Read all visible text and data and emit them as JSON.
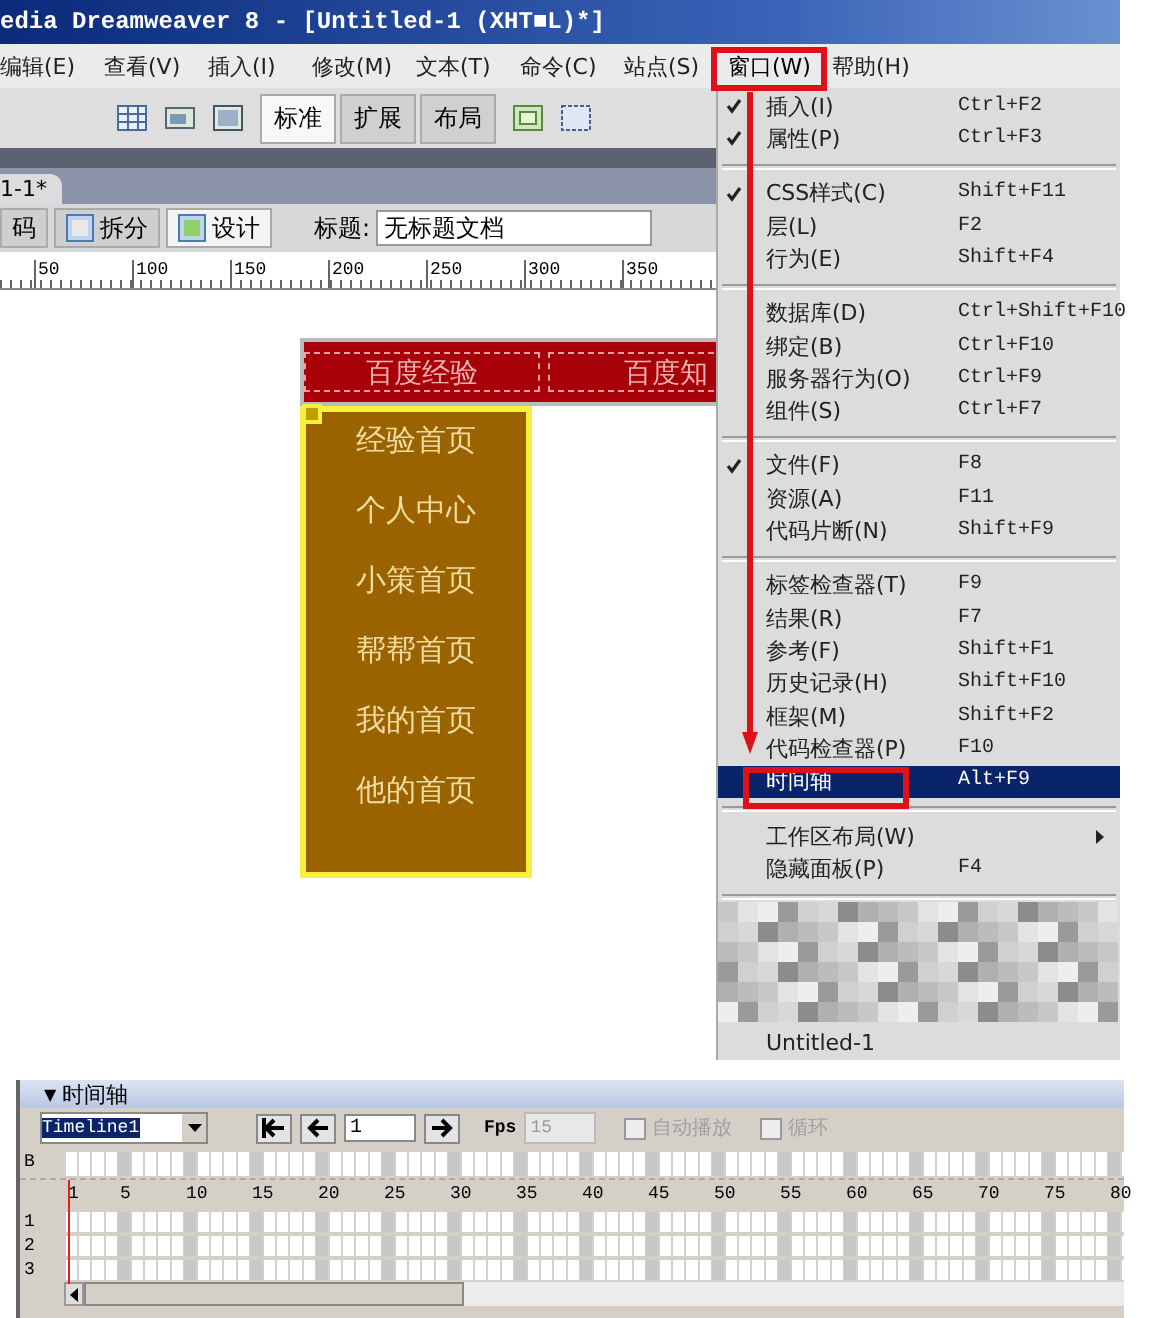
{
  "window": {
    "title": "edia Dreamweaver 8 - [Untitled-1 (XHT■L)*]"
  },
  "menu_bar": [
    {
      "label": "编辑(E)",
      "selected": false
    },
    {
      "label": "查看(V)",
      "selected": false
    },
    {
      "label": "插入(I)",
      "selected": false
    },
    {
      "label": "修改(M)",
      "selected": false
    },
    {
      "label": "文本(T)",
      "selected": false
    },
    {
      "label": "命令(C)",
      "selected": false
    },
    {
      "label": "站点(S)",
      "selected": false
    },
    {
      "label": "窗口(W)",
      "selected": true
    },
    {
      "label": "帮助(H)",
      "selected": false
    }
  ],
  "insert_tabs": [
    {
      "label": "标准",
      "selected": true
    },
    {
      "label": "扩展",
      "selected": false
    },
    {
      "label": "布局",
      "selected": false
    }
  ],
  "document_tab": {
    "label": "1-1*"
  },
  "view_buttons": [
    {
      "label": "码",
      "selected": false
    },
    {
      "label": "拆分",
      "selected": false
    },
    {
      "label": "设计",
      "selected": true
    }
  ],
  "title_field": {
    "label": "标题:",
    "value": "无标题文档"
  },
  "ruler": [
    "50",
    "100",
    "150",
    "200",
    "250",
    "300",
    "350"
  ],
  "nav_menu": {
    "items": [
      "百度经验",
      "百度知"
    ],
    "submenu": [
      "经验首页",
      "个人中心",
      "小策首页",
      "帮帮首页",
      "我的首页",
      "他的首页"
    ]
  },
  "window_menu": [
    [
      {
        "label": "插入(I)",
        "shortcut": "Ctrl+F2",
        "checked": true,
        "selected": false,
        "submenu": false
      },
      {
        "label": "属性(P)",
        "shortcut": "Ctrl+F3",
        "checked": true,
        "selected": false,
        "submenu": false
      }
    ],
    [
      {
        "label": "CSS样式(C)",
        "shortcut": "Shift+F11",
        "checked": true,
        "selected": false,
        "submenu": false
      },
      {
        "label": "层(L)",
        "shortcut": "F2",
        "checked": false,
        "selected": false,
        "submenu": false
      },
      {
        "label": "行为(E)",
        "shortcut": "Shift+F4",
        "checked": false,
        "selected": false,
        "submenu": false
      }
    ],
    [
      {
        "label": "数据库(D)",
        "shortcut": "Ctrl+Shift+F10",
        "checked": false,
        "selected": false,
        "submenu": false
      },
      {
        "label": "绑定(B)",
        "shortcut": "Ctrl+F10",
        "checked": false,
        "selected": false,
        "submenu": false
      },
      {
        "label": "服务器行为(O)",
        "shortcut": "Ctrl+F9",
        "checked": false,
        "selected": false,
        "submenu": false
      },
      {
        "label": "组件(S)",
        "shortcut": "Ctrl+F7",
        "checked": false,
        "selected": false,
        "submenu": false
      }
    ],
    [
      {
        "label": "文件(F)",
        "shortcut": "F8",
        "checked": true,
        "selected": false,
        "submenu": false
      },
      {
        "label": "资源(A)",
        "shortcut": "F11",
        "checked": false,
        "selected": false,
        "submenu": false
      },
      {
        "label": "代码片断(N)",
        "shortcut": "Shift+F9",
        "checked": false,
        "selected": false,
        "submenu": false
      }
    ],
    [
      {
        "label": "标签检查器(T)",
        "shortcut": "F9",
        "checked": false,
        "selected": false,
        "submenu": false
      },
      {
        "label": "结果(R)",
        "shortcut": "F7",
        "checked": false,
        "selected": false,
        "submenu": false
      },
      {
        "label": "参考(F)",
        "shortcut": "Shift+F1",
        "checked": false,
        "selected": false,
        "submenu": false
      },
      {
        "label": "历史记录(H)",
        "shortcut": "Shift+F10",
        "checked": false,
        "selected": false,
        "submenu": false
      },
      {
        "label": "框架(M)",
        "shortcut": "Shift+F2",
        "checked": false,
        "selected": false,
        "submenu": false
      },
      {
        "label": "代码检查器(P)",
        "shortcut": "F10",
        "checked": false,
        "selected": false,
        "submenu": false
      },
      {
        "label": "时间轴",
        "shortcut": "Alt+F9",
        "checked": false,
        "selected": true,
        "submenu": false
      }
    ],
    [
      {
        "label": "工作区布局(W)",
        "checked": false,
        "selected": false,
        "submenu": true
      },
      {
        "label": "隐藏面板(P)",
        "shortcut": "F4",
        "checked": false,
        "selected": false,
        "submenu": false
      }
    ],
    [
      {
        "label": "Untitled-1",
        "checked": false,
        "selected": false,
        "submenu": false
      }
    ]
  ],
  "timeline": {
    "toggle": "▼",
    "title": "时间轴",
    "name": "Timeline1",
    "frame": "1",
    "fps_label": "Fps",
    "fps": "15",
    "options": [
      {
        "label": "自动播放",
        "checked": false,
        "disabled": true
      },
      {
        "label": "循环",
        "checked": false,
        "disabled": true
      }
    ],
    "behavior_row": "B",
    "frame_numbers": [
      "1",
      "5",
      "10",
      "15",
      "20",
      "25",
      "30",
      "35",
      "40",
      "45",
      "50",
      "55",
      "60",
      "65",
      "70",
      "75",
      "80"
    ],
    "layers": [
      "1",
      "2",
      "3"
    ]
  }
}
